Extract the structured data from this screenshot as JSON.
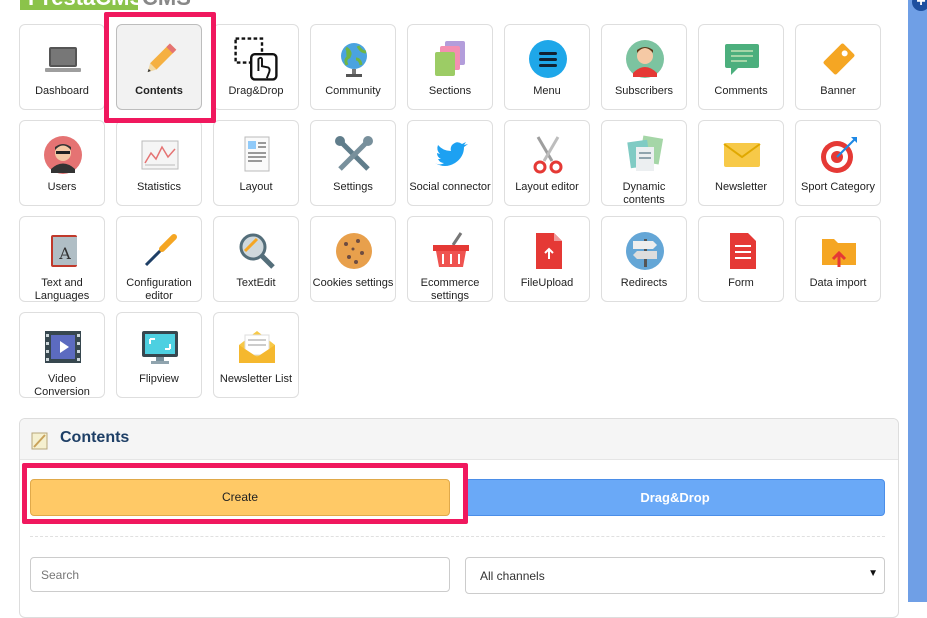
{
  "logo": {
    "text_left": "PrestaCMS",
    "text_right": "CMS"
  },
  "tiles": [
    {
      "label": "Dashboard",
      "icon": "laptop-icon"
    },
    {
      "label": "Contents",
      "icon": "pencil-icon",
      "selected": true
    },
    {
      "label": "Drag&Drop",
      "icon": "drag-drop-icon"
    },
    {
      "label": "Community",
      "icon": "globe-icon"
    },
    {
      "label": "Sections",
      "icon": "sections-icon"
    },
    {
      "label": "Menu",
      "icon": "menu-icon"
    },
    {
      "label": "Subscribers",
      "icon": "subscriber-icon"
    },
    {
      "label": "Comments",
      "icon": "comment-icon"
    },
    {
      "label": "Banner",
      "icon": "tag-icon"
    },
    {
      "label": "Users",
      "icon": "user-icon"
    },
    {
      "label": "Statistics",
      "icon": "statistics-icon"
    },
    {
      "label": "Layout",
      "icon": "layout-icon"
    },
    {
      "label": "Settings",
      "icon": "tools-icon"
    },
    {
      "label": "Social connector",
      "icon": "twitter-icon"
    },
    {
      "label": "Layout editor",
      "icon": "scissors-icon"
    },
    {
      "label": "Dynamic contents",
      "icon": "documents-icon"
    },
    {
      "label": "Newsletter",
      "icon": "envelope-icon"
    },
    {
      "label": "Sport Category",
      "icon": "target-icon"
    },
    {
      "label": "Text and Languages",
      "icon": "book-icon"
    },
    {
      "label": "Configuration editor",
      "icon": "screwdriver-icon"
    },
    {
      "label": "TextEdit",
      "icon": "magnifier-icon"
    },
    {
      "label": "Cookies settings",
      "icon": "cookie-icon"
    },
    {
      "label": "Ecommerce settings",
      "icon": "basket-icon"
    },
    {
      "label": "FileUpload",
      "icon": "file-upload-icon"
    },
    {
      "label": "Redirects",
      "icon": "signpost-icon"
    },
    {
      "label": "Form",
      "icon": "form-icon"
    },
    {
      "label": "Data import",
      "icon": "folder-import-icon"
    },
    {
      "label": "Video Conversion",
      "icon": "film-icon"
    },
    {
      "label": "Flipview",
      "icon": "monitor-icon"
    },
    {
      "label": "Newsletter List",
      "icon": "open-envelope-icon"
    }
  ],
  "panel": {
    "title": "Contents",
    "title_icon": "notepad-icon"
  },
  "actions": {
    "create_label": "Create",
    "dragdrop_label": "Drag&Drop"
  },
  "filters": {
    "search_placeholder": "Search",
    "channel_selected": "All channels"
  },
  "colors": {
    "highlight": "#f0185e",
    "create": "#ffc966",
    "dragdrop": "#6aa9f7",
    "title": "#1e3f66"
  }
}
